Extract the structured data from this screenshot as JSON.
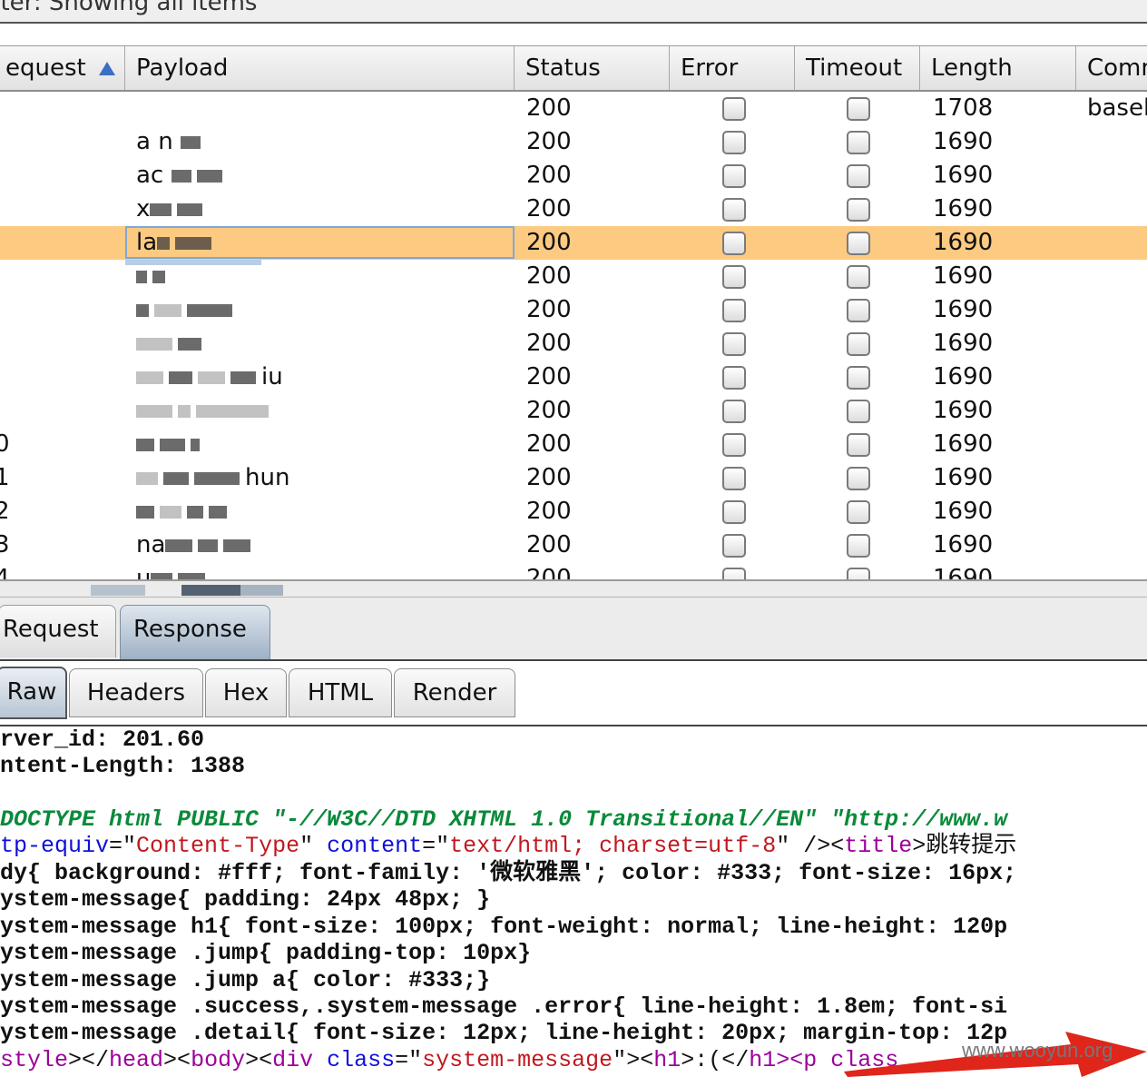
{
  "filter": {
    "text": "ilter: Showing all items"
  },
  "table": {
    "columns": [
      "equest",
      "Payload",
      "Status",
      "Error",
      "Timeout",
      "Length",
      "Comm"
    ],
    "sort_indicator": "ascending",
    "rows": [
      {
        "req": "",
        "payload": "",
        "status": "200",
        "length": "1708",
        "comment": "basel",
        "selected": false
      },
      {
        "req": "",
        "payload": "a  n",
        "status": "200",
        "length": "1690",
        "comment": "",
        "selected": false
      },
      {
        "req": "",
        "payload": "ac",
        "status": "200",
        "length": "1690",
        "comment": "",
        "selected": false
      },
      {
        "req": "",
        "payload": "x",
        "status": "200",
        "length": "1690",
        "comment": "",
        "selected": false
      },
      {
        "req": "",
        "payload": "la",
        "status": "200",
        "length": "1690",
        "comment": "",
        "selected": true
      },
      {
        "req": "",
        "payload": "",
        "status": "200",
        "length": "1690",
        "comment": "",
        "selected": false
      },
      {
        "req": "",
        "payload": "",
        "status": "200",
        "length": "1690",
        "comment": "",
        "selected": false
      },
      {
        "req": "",
        "payload": "",
        "status": "200",
        "length": "1690",
        "comment": "",
        "selected": false
      },
      {
        "req": "",
        "payload": "iu",
        "status": "200",
        "length": "1690",
        "comment": "",
        "selected": false
      },
      {
        "req": "",
        "payload": "",
        "status": "200",
        "length": "1690",
        "comment": "",
        "selected": false
      },
      {
        "req": "0",
        "payload": "",
        "status": "200",
        "length": "1690",
        "comment": "",
        "selected": false
      },
      {
        "req": "1",
        "payload": "hun",
        "status": "200",
        "length": "1690",
        "comment": "",
        "selected": false
      },
      {
        "req": "2",
        "payload": "",
        "status": "200",
        "length": "1690",
        "comment": "",
        "selected": false
      },
      {
        "req": "3",
        "payload": "na",
        "status": "200",
        "length": "1690",
        "comment": "",
        "selected": false
      },
      {
        "req": "4",
        "payload": "u",
        "status": "200",
        "length": "1690",
        "comment": "",
        "selected": false
      }
    ]
  },
  "message_tabs": {
    "request": "Request",
    "response": "Response",
    "active": "response"
  },
  "view_tabs": {
    "items": [
      "Raw",
      "Headers",
      "Hex",
      "HTML",
      "Render"
    ],
    "active": "Raw"
  },
  "response_lines": {
    "l1": "rver_id: 201.60",
    "l2": "ntent-Length: 1388",
    "l3": "DOCTYPE html PUBLIC \"-//W3C//DTD XHTML 1.0 Transitional//EN\" \"http://www.w",
    "l4_attr": "tp-equiv",
    "l4_eq1": "=\"",
    "l4_val1": "Content-Type",
    "l4_q1": "\" ",
    "l4_attr2": "content",
    "l4_eq2": "=\"",
    "l4_val2": "text/html; charset=utf-8",
    "l4_end": "\" /><",
    "l4_tag": "title",
    "l4_text": ">跳转提示",
    "l5": "dy{ background: #fff; font-family: '微软雅黑'; color: #333; font-size: 16px;",
    "l6": "ystem-message{ padding: 24px 48px; }",
    "l7": "ystem-message h1{ font-size: 100px; font-weight: normal; line-height: 120p",
    "l8": "ystem-message .jump{ padding-top: 10px}",
    "l9": "ystem-message .jump a{ color: #333;}",
    "l10": "ystem-message .success,.system-message .error{ line-height: 1.8em; font-si",
    "l11": "ystem-message .detail{ font-size: 12px; line-height: 20px; margin-top: 12p",
    "l12_a": "style",
    "l12_b": "></",
    "l12_c": "head",
    "l12_d": "><",
    "l12_e": "body",
    "l12_f": "><",
    "l12_g": "div",
    "l12_h": " class",
    "l12_i": "=\"",
    "l12_j": "system-message",
    "l12_k": "\"><",
    "l12_l": "h1",
    "l12_m": ">:(</",
    "l12_n": "h1",
    "l12_o": "><p class"
  },
  "watermark": "www.wooyun.org",
  "colors": {
    "selected_row": "#fdca82",
    "sort_arrow": "#3b6fc4",
    "annotation_arrow": "#e0251b"
  }
}
